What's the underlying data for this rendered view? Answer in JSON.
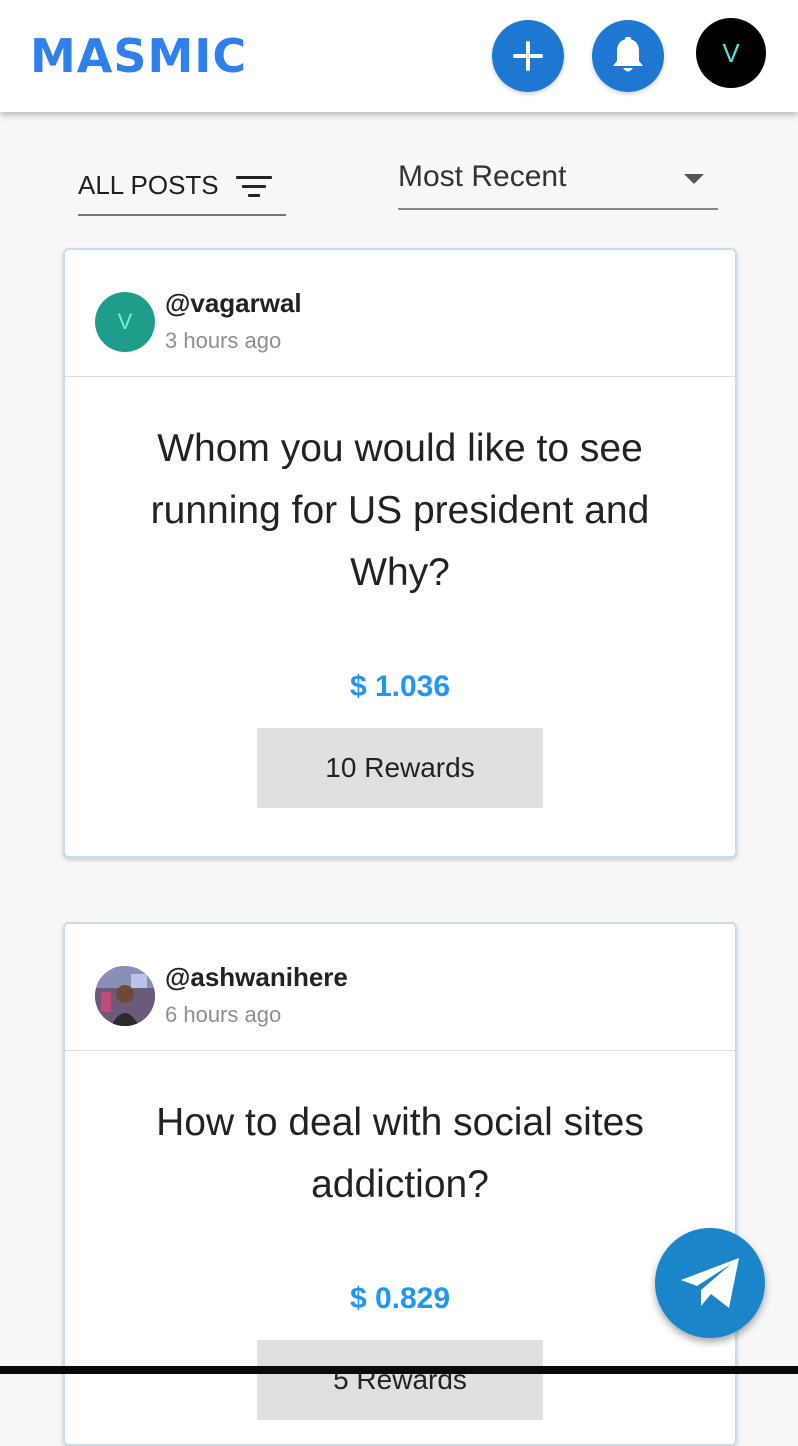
{
  "header": {
    "logo_text": "masmic",
    "profile_initial": "V"
  },
  "filters": {
    "all_posts_label": "ALL POSTS",
    "sort_selected": "Most Recent"
  },
  "posts": [
    {
      "avatar_initial": "V",
      "avatar_color": "#1e9e8a",
      "username": "@vagarwal",
      "time": "3 hours ago",
      "question_line1": "Whom you would like to see",
      "question_line2": "running for US president and",
      "question_line3": "Why?",
      "amount": "$ 1.036",
      "rewards_label": "10 Rewards"
    },
    {
      "username": "@ashwanihere",
      "time": "6 hours ago",
      "question_line1": "How to deal with social sites",
      "question_line2": "addiction?",
      "amount": "$ 0.829",
      "rewards_label": "5 Rewards"
    }
  ],
  "colors": {
    "brand_blue": "#1e78d2",
    "amount_blue": "#2196f3",
    "fab_blue": "#1a85c9"
  }
}
